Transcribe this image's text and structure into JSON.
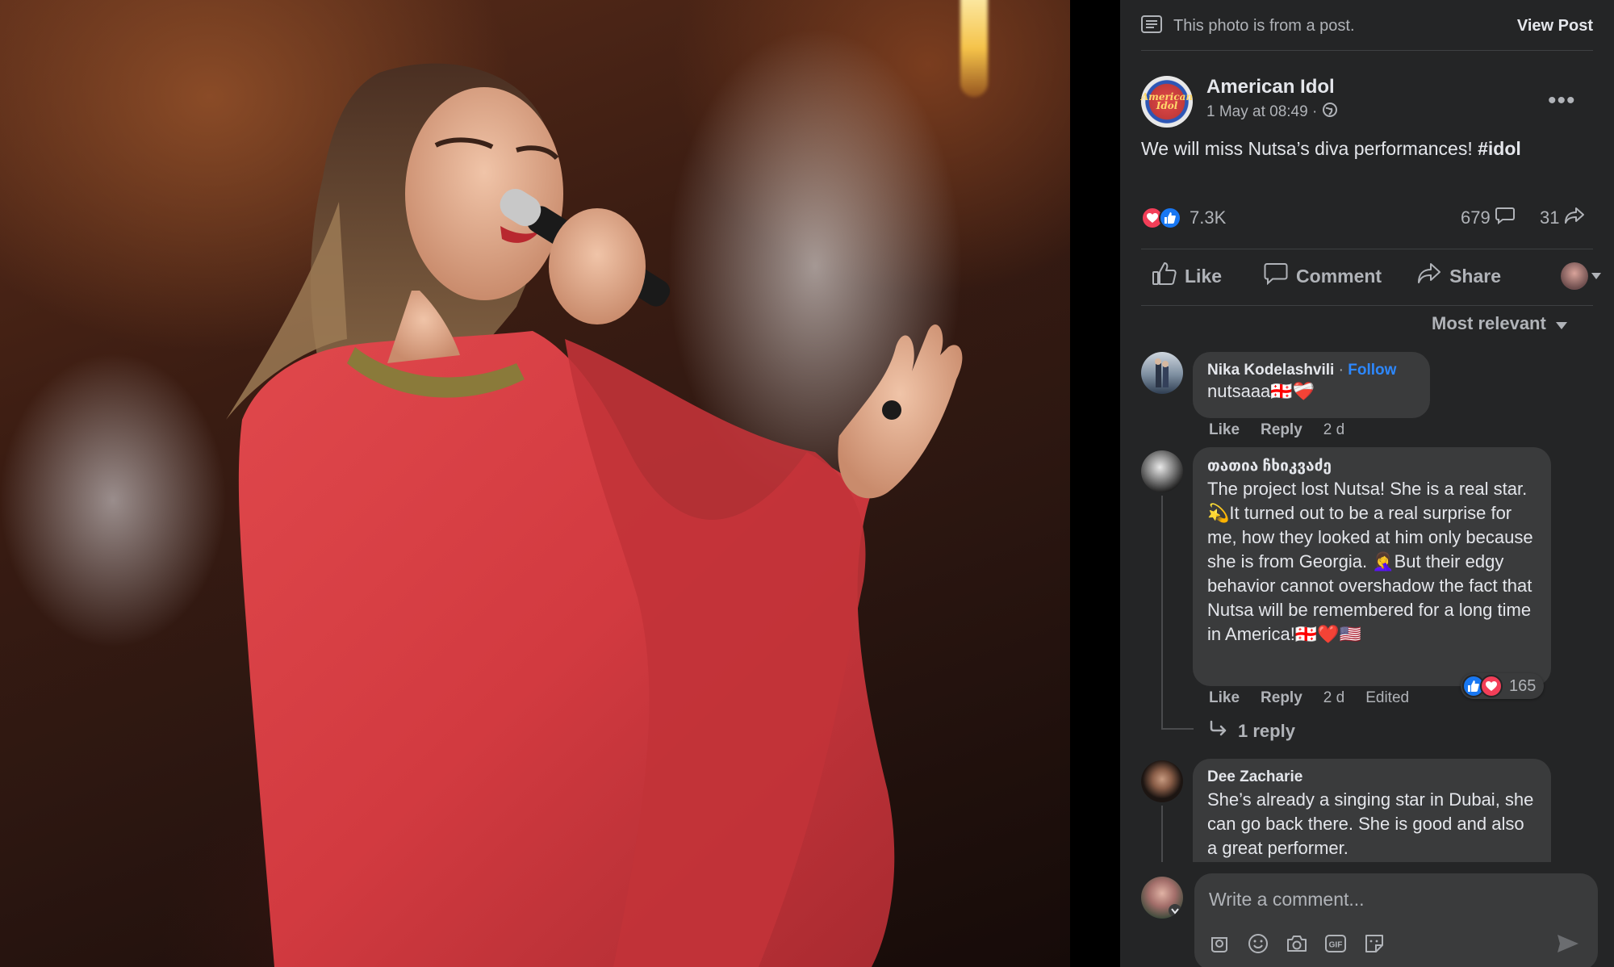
{
  "post_notice": {
    "text": "This photo is from a post.",
    "view_post": "View Post"
  },
  "post": {
    "page_name": "American Idol",
    "avatar_logo": "American Idol",
    "timestamp": "1 May at 08:49 ·",
    "audience_icon": "globe-icon",
    "text": "We will miss Nutsa’s diva performances! ",
    "hashtag": "#idol",
    "reaction_count": "7.3K",
    "comment_count": "679",
    "share_count": "31"
  },
  "actions": {
    "like": "Like",
    "comment": "Comment",
    "share": "Share"
  },
  "sort": {
    "label": "Most relevant"
  },
  "comments": [
    {
      "name": "Nika Kodelashvili",
      "follow_sep": " · ",
      "follow": "Follow",
      "text": "nutsaaa🇬🇪❤️‍🩹",
      "like": "Like",
      "reply": "Reply",
      "age": "2 d"
    },
    {
      "name": "თათია ჩხიკვაძე",
      "text": "The project lost Nutsa! She is a real star. 💫It turned out to be a real surprise for me, how they looked at him only because she is from Georgia. 🤦‍♀️But their edgy behavior cannot overshadow the fact that Nutsa will be remembered for a long time in America!🇬🇪❤️🇺🇸",
      "like": "Like",
      "reply": "Reply",
      "age": "2 d",
      "edited": "Edited",
      "reaction_count": "165",
      "replies_link": "1 reply"
    },
    {
      "name": "Dee Zacharie",
      "text": "She’s already a singing star in Dubai, she can go back there. She is good and also a great performer."
    }
  ],
  "composer": {
    "placeholder": "Write a comment...",
    "tools": [
      "avatar-sticker-icon",
      "emoji-icon",
      "camera-icon",
      "gif-icon",
      "sticker-icon"
    ]
  },
  "colors": {
    "panel_bg": "#242526",
    "bubble_bg": "#3a3b3c",
    "text_primary": "#e4e6eb",
    "text_secondary": "#b0b3b8",
    "link_blue": "#2d88ff",
    "love_red": "#f33e58",
    "like_blue": "#1877f2"
  }
}
